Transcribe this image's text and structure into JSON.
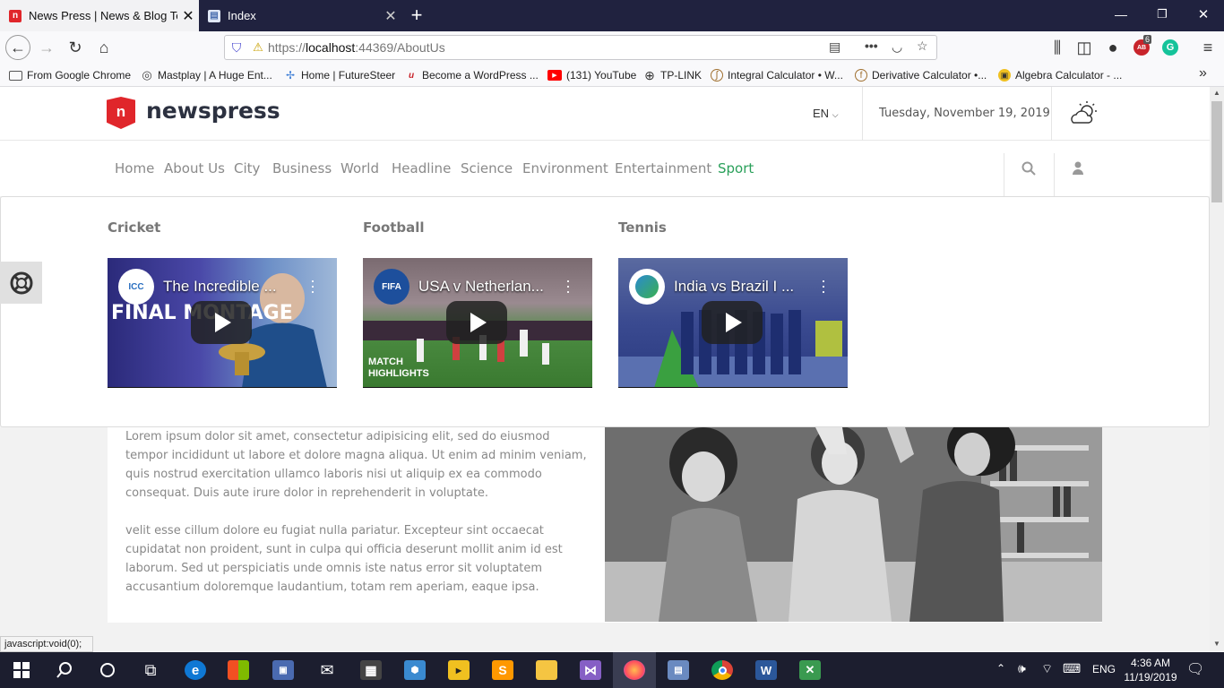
{
  "browser": {
    "tabs": [
      {
        "title": "News Press | News & Blog Template",
        "active": true,
        "icon": "newspress-favicon"
      },
      {
        "title": "Index",
        "active": false,
        "icon": "page-icon"
      }
    ],
    "new_tab_label": "+",
    "url_prefix": "https://",
    "url_host": "localhost",
    "url_rest": ":44369/AboutUs",
    "badge_count": "6",
    "bookmarks": [
      {
        "label": "From Google Chrome",
        "icon": "folder-icon"
      },
      {
        "label": "Mastplay | A Huge Ent...",
        "icon": "mastplay-icon"
      },
      {
        "label": "Home | FutureSteer",
        "icon": "futuresteer-icon"
      },
      {
        "label": "Become a WordPress ...",
        "icon": "wordpress-icon"
      },
      {
        "label": "(131) YouTube",
        "icon": "youtube-icon"
      },
      {
        "label": "TP-LINK",
        "icon": "globe-icon"
      },
      {
        "label": "Integral Calculator • W...",
        "icon": "calculator-icon"
      },
      {
        "label": "Derivative Calculator •...",
        "icon": "calculator-icon"
      },
      {
        "label": "Algebra Calculator - ...",
        "icon": "algebra-icon"
      }
    ],
    "status_text": "javascript:void(0);"
  },
  "site": {
    "logo_text": "newspress",
    "language": "EN",
    "date": "Tuesday, November 19, 2019",
    "weather_icon": "cloud-sun-icon",
    "menu": [
      "Home",
      "About Us",
      "City",
      "Business",
      "World",
      "Headline",
      "Science",
      "Environment",
      "Entertainment",
      "Sport"
    ],
    "active_menu": "Sport",
    "accent_color": "#2aa05a",
    "brand_color": "#e0262b"
  },
  "mega_menu": {
    "columns": [
      {
        "heading": "Cricket",
        "video_title": "The Incredible ...",
        "channel": "ICC",
        "overlay": "FINAL MONTAGE"
      },
      {
        "heading": "Football",
        "video_title": "USA v Netherlan...",
        "channel": "FIFA",
        "overlay": "MATCH HIGHLIGHTS"
      },
      {
        "heading": "Tennis",
        "video_title": "India vs Brazil I ...",
        "channel": "",
        "overlay": ""
      }
    ]
  },
  "content": {
    "para1": "Lorem ipsum dolor sit amet, consectetur adipisicing elit, sed do eiusmod tempor incididunt ut labore et dolore magna aliqua. Ut enim ad minim veniam, quis nostrud exercitation ullamco laboris nisi ut aliquip ex ea commodo consequat. Duis aute irure dolor in reprehenderit in voluptate.",
    "para2": "velit esse cillum dolore eu fugiat nulla pariatur. Excepteur sint occaecat cupidatat non proident, sunt in culpa qui officia deserunt mollit anim id est laborum. Sed ut perspiciatis unde omnis iste natus error sit voluptatem accusantium doloremque laudantium, totam rem aperiam, eaque ipsa."
  },
  "taskbar": {
    "time": "4:36 AM",
    "date": "11/19/2019",
    "language": "ENG",
    "apps": [
      "start-icon",
      "search-icon",
      "cortana-icon",
      "task-view-icon",
      "edge-icon",
      "store-icon",
      "ms-teams-icon",
      "mail-icon",
      "calculator-icon",
      "3d-viewer-icon",
      "player-icon",
      "sublime-icon",
      "file-explorer-icon",
      "visual-studio-icon",
      "firefox-icon",
      "remote-desktop-icon",
      "chrome-icon",
      "word-icon",
      "app-icon"
    ]
  }
}
